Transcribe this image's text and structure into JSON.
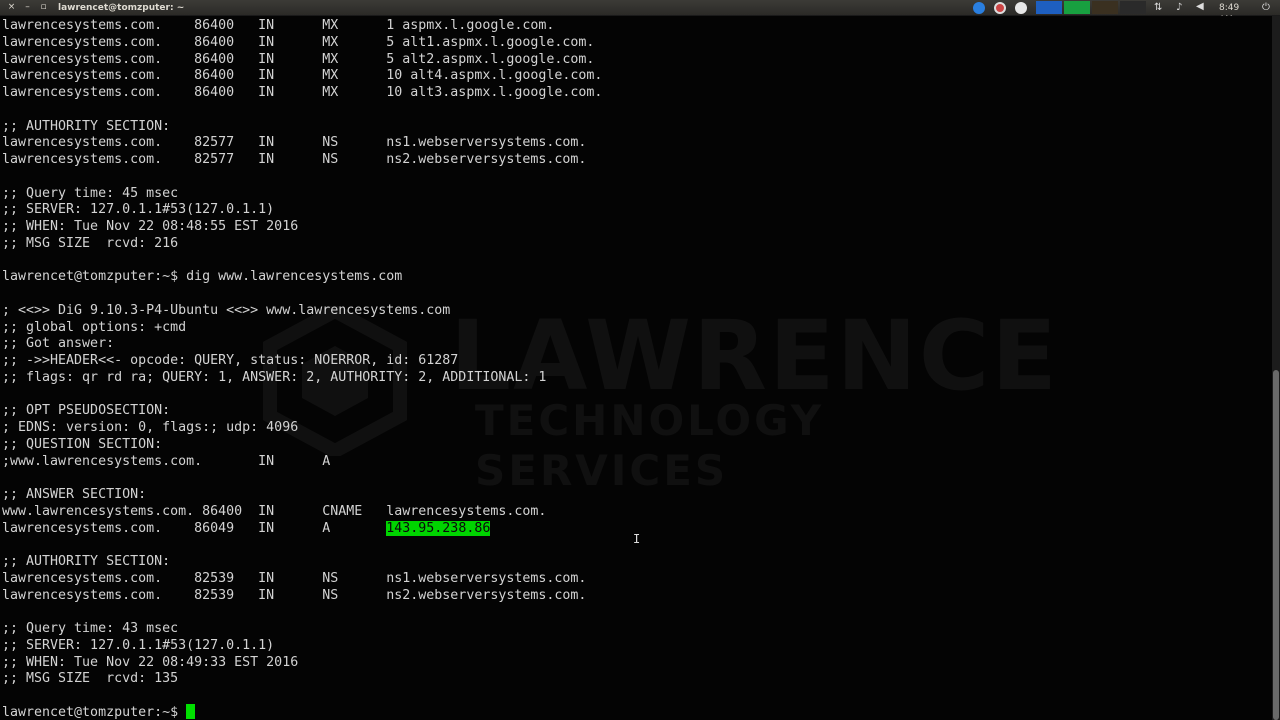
{
  "window": {
    "title": "lawrencet@tomzputer: ~",
    "close_glyph": "×",
    "minimize_glyph": "–",
    "maximize_glyph": "▫"
  },
  "tray": {
    "clock": "8:49 AM",
    "icons": [
      "chromium-icon",
      "lifesaver-icon",
      "update-icon",
      "network-graph-icon",
      "memory-graph-icon",
      "cpu-graph-icon",
      "transfer-icon",
      "bell-icon",
      "volume-icon",
      "power-icon"
    ]
  },
  "terminal": {
    "lines": [
      "lawrencesystems.com.    86400   IN      MX      1 aspmx.l.google.com.",
      "lawrencesystems.com.    86400   IN      MX      5 alt1.aspmx.l.google.com.",
      "lawrencesystems.com.    86400   IN      MX      5 alt2.aspmx.l.google.com.",
      "lawrencesystems.com.    86400   IN      MX      10 alt4.aspmx.l.google.com.",
      "lawrencesystems.com.    86400   IN      MX      10 alt3.aspmx.l.google.com.",
      "",
      ";; AUTHORITY SECTION:",
      "lawrencesystems.com.    82577   IN      NS      ns1.webserversystems.com.",
      "lawrencesystems.com.    82577   IN      NS      ns2.webserversystems.com.",
      "",
      ";; Query time: 45 msec",
      ";; SERVER: 127.0.1.1#53(127.0.1.1)",
      ";; WHEN: Tue Nov 22 08:48:55 EST 2016",
      ";; MSG SIZE  rcvd: 216",
      "",
      "lawrencet@tomzputer:~$ dig www.lawrencesystems.com",
      "",
      "; <<>> DiG 9.10.3-P4-Ubuntu <<>> www.lawrencesystems.com",
      ";; global options: +cmd",
      ";; Got answer:",
      ";; ->>HEADER<<- opcode: QUERY, status: NOERROR, id: 61287",
      ";; flags: qr rd ra; QUERY: 1, ANSWER: 2, AUTHORITY: 2, ADDITIONAL: 1",
      "",
      ";; OPT PSEUDOSECTION:",
      "; EDNS: version: 0, flags:; udp: 4096",
      ";; QUESTION SECTION:",
      ";www.lawrencesystems.com.       IN      A",
      "",
      ";; ANSWER SECTION:",
      "www.lawrencesystems.com. 86400  IN      CNAME   lawrencesystems.com.",
      "",
      "",
      ";; AUTHORITY SECTION:",
      "lawrencesystems.com.    82539   IN      NS      ns1.webserversystems.com.",
      "lawrencesystems.com.    82539   IN      NS      ns2.webserversystems.com.",
      "",
      ";; Query time: 43 msec",
      ";; SERVER: 127.0.1.1#53(127.0.1.1)",
      ";; WHEN: Tue Nov 22 08:49:33 EST 2016",
      ";; MSG SIZE  rcvd: 135",
      "",
      ""
    ],
    "a_record_prefix": "lawrencesystems.com.    86049   IN      A       ",
    "a_record_ip": "143.95.238.86",
    "prompt": "lawrencet@tomzputer:~$ ",
    "highlight_color": "#00d400"
  },
  "watermark": {
    "big": "LAWRENCE",
    "small": "TECHNOLOGY SERVICES"
  }
}
